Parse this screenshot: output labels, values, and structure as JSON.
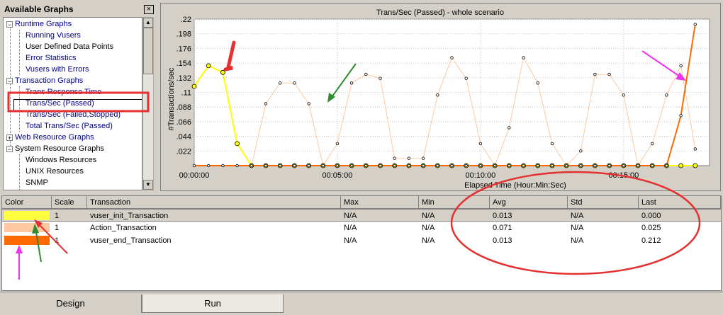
{
  "tree": {
    "title": "Available Graphs",
    "close_glyph": "×",
    "items": [
      {
        "label": "Runtime Graphs",
        "expander": "−",
        "level": 0
      },
      {
        "label": "Running Vusers",
        "level": 1
      },
      {
        "label": "User Defined Data Points",
        "level": 1,
        "color": "black"
      },
      {
        "label": "Error Statistics",
        "level": 1
      },
      {
        "label": "Vusers with Errors",
        "level": 1
      },
      {
        "label": "Transaction Graphs",
        "expander": "−",
        "level": 0
      },
      {
        "label": "Trans Response Time",
        "level": 1
      },
      {
        "label": "Trans/Sec (Passed)",
        "level": 1,
        "selected": true
      },
      {
        "label": "Trans/Sec (Failed,Stopped)",
        "level": 1
      },
      {
        "label": "Total Trans/Sec (Passed)",
        "level": 1
      },
      {
        "label": "Web Resource Graphs",
        "expander": "+",
        "level": 0
      },
      {
        "label": "System Resource Graphs",
        "expander": "−",
        "level": 0,
        "color": "black"
      },
      {
        "label": "Windows Resources",
        "level": 1,
        "color": "black"
      },
      {
        "label": "UNIX Resources",
        "level": 1,
        "color": "black"
      },
      {
        "label": "SNMP",
        "level": 1,
        "color": "black"
      }
    ]
  },
  "chart_data": {
    "type": "line",
    "title": "Trans/Sec (Passed) - whole scenario",
    "xlabel": "Elapsed Time (Hour:Min:Sec)",
    "ylabel": "#Transactions/sec",
    "x_ticks": [
      "00:00:00",
      "00:05:00",
      "00:10:00",
      "00:15:00"
    ],
    "x_tick_minutes": [
      0,
      5,
      10,
      15
    ],
    "y_ticks": [
      ".022",
      ".044",
      ".066",
      ".088",
      ".11",
      ".132",
      ".154",
      ".176",
      ".198",
      ".22"
    ],
    "ylim": [
      0,
      0.22
    ],
    "xlim_minutes": [
      0,
      18
    ],
    "grid": true,
    "series": [
      {
        "name": "vuser_init_Transaction",
        "color": "#ffff00",
        "x_minutes": [
          0,
          0.5,
          1.0,
          1.5,
          2.0,
          2.5,
          3.0,
          3.5,
          4.0,
          4.5,
          5.0,
          5.5,
          6.0,
          6.5,
          7.0,
          7.5,
          8.0,
          8.5,
          9.0,
          9.5,
          10.0,
          10.5,
          11.0,
          11.5,
          12.0,
          12.5,
          13.0,
          13.5,
          14.0,
          14.5,
          15.0,
          15.5,
          16.0,
          16.5,
          17.0,
          17.5
        ],
        "y": [
          0.119,
          0.15,
          0.14,
          0.033,
          0,
          0,
          0,
          0,
          0,
          0,
          0,
          0,
          0,
          0,
          0,
          0,
          0,
          0,
          0,
          0,
          0,
          0,
          0,
          0,
          0,
          0,
          0,
          0,
          0,
          0,
          0,
          0,
          0,
          0,
          0,
          0
        ]
      },
      {
        "name": "Action_Transaction",
        "color": "#ffc8a0",
        "x_minutes": [
          0,
          0.5,
          1.0,
          1.5,
          2.0,
          2.5,
          3.0,
          3.5,
          4.0,
          4.5,
          5.0,
          5.5,
          6.0,
          6.5,
          7.0,
          7.5,
          8.0,
          8.5,
          9.0,
          9.5,
          10.0,
          10.5,
          11.0,
          11.5,
          12.0,
          12.5,
          13.0,
          13.5,
          14.0,
          14.5,
          15.0,
          15.5,
          16.0,
          16.5,
          17.0,
          17.5
        ],
        "y": [
          0.119,
          0.15,
          0.14,
          0.033,
          0,
          0.093,
          0.124,
          0.124,
          0.093,
          0,
          0.033,
          0.124,
          0.137,
          0.131,
          0.011,
          0.011,
          0.011,
          0.106,
          0.162,
          0.131,
          0.033,
          0,
          0.057,
          0.162,
          0.124,
          0.033,
          0,
          0.022,
          0.137,
          0.137,
          0.106,
          0,
          0.033,
          0.106,
          0.15,
          0.025
        ]
      },
      {
        "name": "vuser_end_Transaction",
        "color": "#ff6a00",
        "x_minutes": [
          0,
          0.5,
          1.0,
          1.5,
          2.0,
          2.5,
          3.0,
          3.5,
          4.0,
          4.5,
          5.0,
          5.5,
          6.0,
          6.5,
          7.0,
          7.5,
          8.0,
          8.5,
          9.0,
          9.5,
          10.0,
          10.5,
          11.0,
          11.5,
          12.0,
          12.5,
          13.0,
          13.5,
          14.0,
          14.5,
          15.0,
          15.5,
          16.0,
          16.5,
          17.0,
          17.5
        ],
        "y": [
          0,
          0,
          0,
          0,
          0,
          0,
          0,
          0,
          0,
          0,
          0,
          0,
          0,
          0,
          0,
          0,
          0,
          0,
          0,
          0,
          0,
          0,
          0,
          0,
          0,
          0,
          0,
          0,
          0,
          0,
          0,
          0,
          0,
          0,
          0.075,
          0.212
        ]
      }
    ]
  },
  "table": {
    "columns": [
      "Color",
      "Scale",
      "Transaction",
      "Max",
      "Min",
      "Avg",
      "Std",
      "Last"
    ],
    "rows": [
      {
        "color": "#ffff40",
        "scale": "1",
        "transaction": "vuser_init_Transaction",
        "max": "N/A",
        "min": "N/A",
        "avg": "0.013",
        "std": "N/A",
        "last": "0.000",
        "selected": true
      },
      {
        "color": "#ffc8a0",
        "scale": "1",
        "transaction": "Action_Transaction",
        "max": "N/A",
        "min": "N/A",
        "avg": "0.071",
        "std": "N/A",
        "last": "0.025"
      },
      {
        "color": "#ff6a00",
        "scale": "1",
        "transaction": "vuser_end_Transaction",
        "max": "N/A",
        "min": "N/A",
        "avg": "0.013",
        "std": "N/A",
        "last": "0.212"
      }
    ]
  },
  "tabs": [
    {
      "label": "Design",
      "active": false
    },
    {
      "label": "Run",
      "active": true
    }
  ],
  "annotation_colors": {
    "red": "#e53030",
    "green": "#2e8b2e",
    "magenta": "#ee33ee"
  }
}
